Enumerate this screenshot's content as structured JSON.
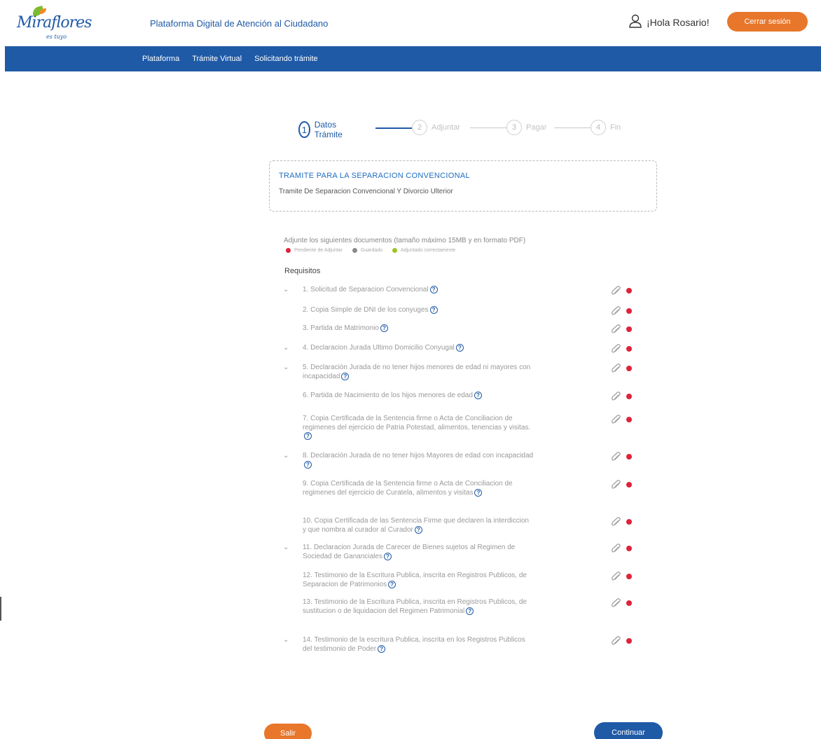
{
  "header": {
    "logo_text": "Miraflores",
    "logo_sub": "es tuyo",
    "app_title": "Plataforma Digital de Atención al Ciudadano",
    "greeting": "¡Hola Rosario!",
    "logout_label": "Cerrar sesión"
  },
  "nav": {
    "items": [
      "Plataforma",
      "Trámite Virtual",
      "Solicitando trámite"
    ]
  },
  "stepper": {
    "steps": [
      {
        "number": "1",
        "label": "Datos Trámite",
        "active": true
      },
      {
        "number": "2",
        "label": "Adjuntar",
        "active": false
      },
      {
        "number": "3",
        "label": "Pagar",
        "active": false
      },
      {
        "number": "4",
        "label": "Fin",
        "active": false
      }
    ]
  },
  "tramite": {
    "title": "TRAMITE PARA LA SEPARACION CONVENCIONAL",
    "subtitle": "Tramite De Separacion Convencional Y Divorcio Ulterior"
  },
  "instructions": "Adjunte los siguientes documentos (tamaño máximo 15MB y en formato PDF)",
  "legend": [
    {
      "label": "Pendiente de Adjuntar",
      "color": "#e0223a"
    },
    {
      "label": "Guardado",
      "color": "#8a8a8a"
    },
    {
      "label": "Adjuntado correctamente",
      "color": "#9cc424"
    }
  ],
  "requisitos_title": "Requisitos",
  "requirements": [
    {
      "text": "1. Solicitud de Separacion Convencional",
      "chevron": true
    },
    {
      "text": "2. Copia Simple de DNI de los conyuges",
      "chevron": false
    },
    {
      "text": "3. Partida de Matrimonio",
      "chevron": false
    },
    {
      "text": "4. Declaracion Jurada Ultimo Domicilio Conyugal",
      "chevron": true
    },
    {
      "text": "5. Declaración Jurada de no tener hijos menores de edad ni mayores con incapacidad",
      "chevron": true
    },
    {
      "text": "6. Partida de Nacimiento de los hijos menores de edad",
      "chevron": false
    },
    {
      "text": "7. Copia Certificada de la Sentencia firme o Acta de Conciliacion de regimenes del ejercicio de Patria Potestad, alimentos, tenencias y visitas.",
      "chevron": false
    },
    {
      "text": "8. Declaración Jurada de no tener hijos Mayores de edad con incapacidad",
      "chevron": true
    },
    {
      "text": "9. Copia Certificada de la Sentencia firme o Acta de Conciliacion de regimenes del ejercicio de Curatela, alimentos y visitas",
      "chevron": false
    },
    {
      "text": "10. Copia Certificada de las Sentencia Firme que declaren la interdiccion y que nombra al curador al Curador",
      "chevron": false
    },
    {
      "text": "11. Declaracion Jurada de Carecer de Bienes sujetos al Regimen de Sociedad de Gananciales",
      "chevron": true
    },
    {
      "text": "12. Testimonio de la Escritura Publica, inscrita en Registros Publicos, de Separacion de Patrimonios",
      "chevron": false
    },
    {
      "text": "13. Testimonio de la Escritura Publica, inscrita en Registros Publicos, de sustitucion o de liquidacion del Regimen Patrimonial",
      "chevron": false
    },
    {
      "text": "14. Testimonio de la escritura Publica, inscrita en los Registros Publicos del testimonio de Poder",
      "chevron": true
    }
  ],
  "buttons": {
    "exit": "Salir",
    "continue": "Continuar"
  },
  "colors": {
    "primary": "#1f5aa6",
    "accent": "#e8762b",
    "pending": "#e0223a"
  }
}
